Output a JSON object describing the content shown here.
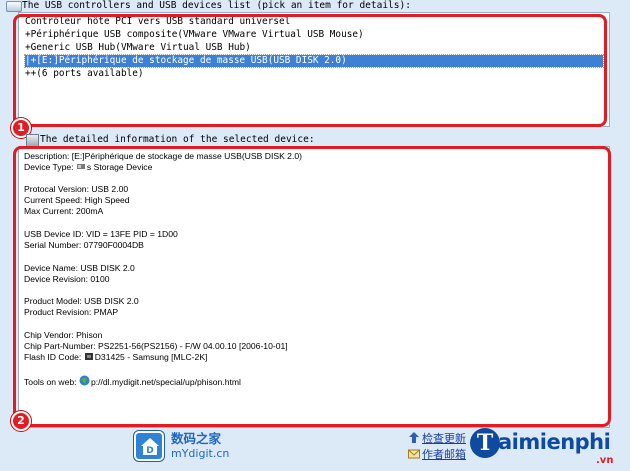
{
  "device_list": {
    "label": "The USB controllers and USB devices list (pick an item for details):",
    "items": [
      "Contrôleur hôte PCI vers USB standard universel",
      "+Périphérique USB composite(VMware VMware Virtual USB Mouse)",
      "+Generic USB Hub(VMware Virtual USB Hub)",
      "|+[E:]Périphérique de stockage de masse USB(USB DISK 2.0)",
      "++(6 ports available)"
    ],
    "selected_index": 3
  },
  "details": {
    "label": "The detailed information of the selected device:",
    "lines": [
      "Description: [E:]Périphérique de stockage de masse USB(USB DISK 2.0)",
      "s Storage Device",
      "Protocal Version: USB 2.00",
      "Current Speed: High Speed",
      "Max Current: 200mA",
      "USB Device ID: VID = 13FE PID = 1D00",
      "Serial Number: 07790F0004DB",
      "Device Name: USB DISK 2.0",
      "Device Revision: 0100",
      "Product Model: USB DISK 2.0",
      "Product Revision: PMAP",
      "Chip Vendor: Phison",
      "Chip Part-Number: PS2251-56(PS2156) - F/W 04.00.10 [2006-10-01]",
      "D31425 - Samsung [MLC-2K]",
      "p://dl.mydigit.net/special/up/phison.html"
    ],
    "device_type_prefix": "Device Type:",
    "flash_id_prefix": "Flash ID Code:",
    "tools_prefix": "Tools on web:"
  },
  "badges": [
    "1",
    "2"
  ],
  "footer": {
    "logo_cn": "数码之家",
    "logo_en": "mYdigit.cn",
    "check_update": "检查更新",
    "author_email": "作者邮箱"
  },
  "watermark": {
    "brand": "aimienphi",
    "suffix": ".vn"
  },
  "colors": {
    "selection": "#3d81d5",
    "highlight_border": "#e31b23",
    "background": "#dce9f7"
  }
}
